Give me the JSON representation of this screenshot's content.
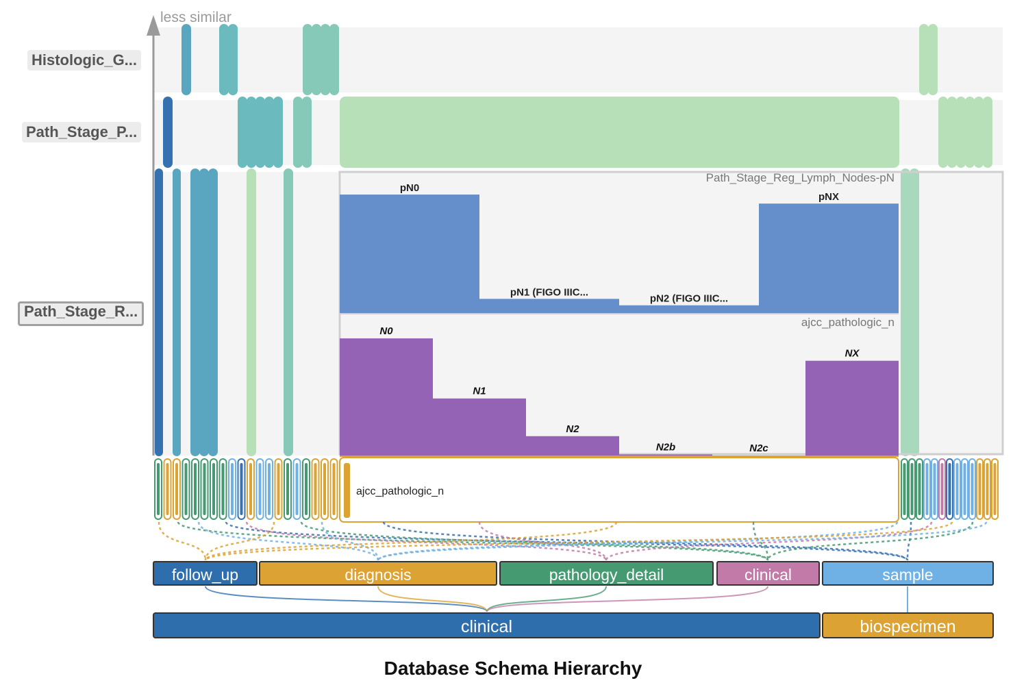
{
  "title": "Database Schema Hierarchy",
  "axis_note": "less similar",
  "row_labels": [
    "Histologic_G...",
    "Path_Stage_P...",
    "Path_Stage_R..."
  ],
  "colors": {
    "blue_dark": "#3570b0",
    "teal": "#5aa6c0",
    "teal_mid": "#6bbbbe",
    "sea": "#86c9b8",
    "green_light": "#b7e0b9",
    "bar_blue": "#648fca",
    "bar_purple": "#9563b6",
    "gold": "#dca233",
    "green": "#469a72",
    "pink": "#c27ba8",
    "sky": "#6fb1e4"
  },
  "chart_data": [
    {
      "type": "bar",
      "title": "Path_Stage_Reg_Lymph_Nodes-pN",
      "categories": [
        "pN0",
        "pN1 (FIGO IIIC...",
        "pN2 (FIGO IIIC...",
        "pNX"
      ],
      "values": [
        0.92,
        0.11,
        0.06,
        0.85
      ],
      "ylim": [
        0,
        1
      ]
    },
    {
      "type": "bar",
      "title": "ajcc_pathologic_n",
      "categories": [
        "N0",
        "N1",
        "N2",
        "N2b",
        "N2c",
        "NX"
      ],
      "values": [
        1.0,
        0.49,
        0.17,
        0.015,
        0.005,
        0.81
      ],
      "ylim": [
        0,
        1
      ]
    }
  ],
  "selected_field": "ajcc_pathologic_n",
  "tables": [
    {
      "name": "follow_up",
      "color": "#2f6ead"
    },
    {
      "name": "diagnosis",
      "color": "#dca233"
    },
    {
      "name": "pathology_detail",
      "color": "#469a72"
    },
    {
      "name": "clinical",
      "color": "#c27ba8"
    },
    {
      "name": "sample",
      "color": "#6fb1e4"
    }
  ],
  "databases": [
    {
      "name": "clinical",
      "color": "#2f6ead"
    },
    {
      "name": "biospecimen",
      "color": "#dca233"
    }
  ]
}
